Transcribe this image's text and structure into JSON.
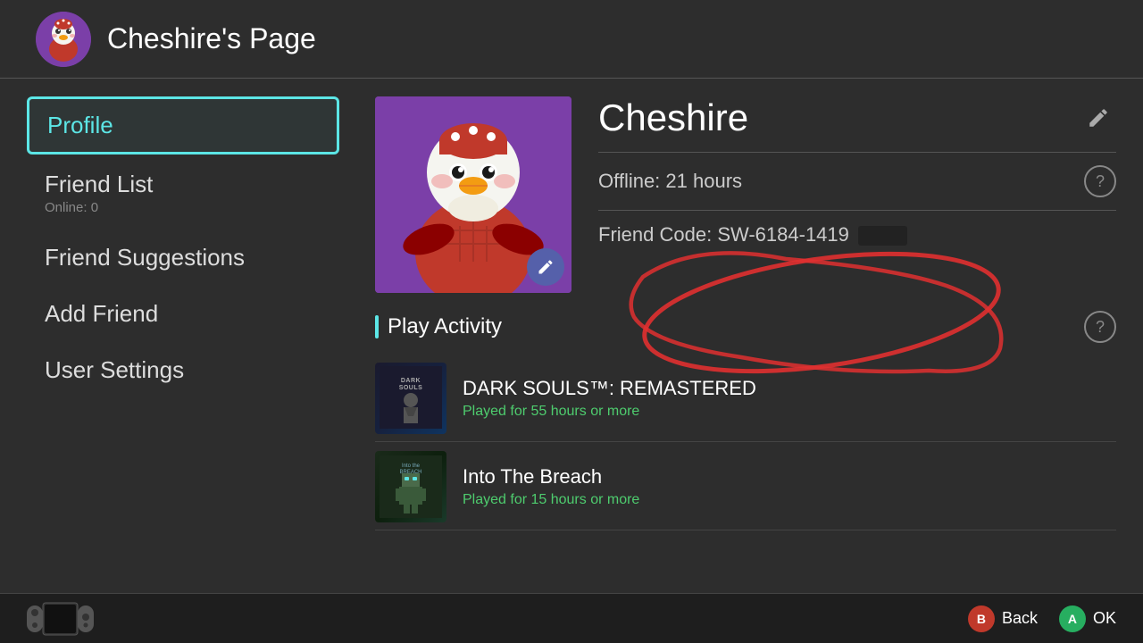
{
  "header": {
    "title": "Cheshire's Page",
    "avatar_emoji": "🦅"
  },
  "sidebar": {
    "items": [
      {
        "id": "profile",
        "label": "Profile",
        "active": true,
        "subtext": ""
      },
      {
        "id": "friend-list",
        "label": "Friend List",
        "active": false,
        "subtext": "Online: 0"
      },
      {
        "id": "friend-suggestions",
        "label": "Friend Suggestions",
        "active": false,
        "subtext": ""
      },
      {
        "id": "add-friend",
        "label": "Add Friend",
        "active": false,
        "subtext": ""
      },
      {
        "id": "user-settings",
        "label": "User Settings",
        "active": false,
        "subtext": ""
      }
    ]
  },
  "profile": {
    "username": "Cheshire",
    "status": "Offline: 21 hours",
    "friend_code_label": "Friend Code:",
    "friend_code": "SW-6184-1419",
    "play_activity_label": "Play Activity"
  },
  "games": [
    {
      "id": "dark-souls",
      "title": "DARK SOULS™: REMASTERED",
      "playtime": "Played for 55 hours or more",
      "thumb_label": "DARK SOULS"
    },
    {
      "id": "into-the-breach",
      "title": "Into The Breach",
      "playtime": "Played for 15 hours or more",
      "thumb_label": "ITB"
    }
  ],
  "bottom": {
    "back_label": "Back",
    "ok_label": "OK",
    "btn_b": "B",
    "btn_a": "A"
  }
}
